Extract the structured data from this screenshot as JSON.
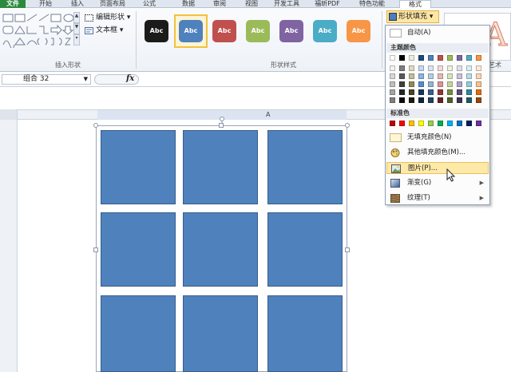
{
  "tabs": [
    {
      "label": "文件",
      "kind": "file"
    },
    {
      "label": "开始"
    },
    {
      "label": "插入"
    },
    {
      "label": "页面布局"
    },
    {
      "label": "公式"
    },
    {
      "label": "数据"
    },
    {
      "label": "审阅"
    },
    {
      "label": "视图"
    },
    {
      "label": "开发工具"
    },
    {
      "label": "福昕PDF"
    },
    {
      "label": "特色功能"
    },
    {
      "label": "格式",
      "kind": "active"
    }
  ],
  "ribbon": {
    "insert_shapes": {
      "edit_shape_label": "编辑形状",
      "text_box_label": "文本框",
      "group_label": "插入形状"
    },
    "shape_styles": {
      "group_label": "形状样式",
      "swatch_text": "Abc",
      "swatches": [
        {
          "color": "#1b1b1b"
        },
        {
          "color": "#4f81bd",
          "selected": true
        },
        {
          "color": "#c0504d"
        },
        {
          "color": "#9bbb59"
        },
        {
          "color": "#8064a2"
        },
        {
          "color": "#4bacc6"
        },
        {
          "color": "#f79646"
        }
      ]
    },
    "fill_button_label": "形状填充",
    "art_group_label": "艺术"
  },
  "formula_bar": {
    "name_box": "组合 32",
    "fx_label": "fx"
  },
  "sheet": {
    "column_header": "A"
  },
  "dropdown": {
    "auto_label": "自动(A)",
    "theme_colors_header": "主题颜色",
    "standard_colors_header": "标准色",
    "no_fill_label": "无填充颜色(N)",
    "more_colors_label": "其他填充颜色(M)...",
    "picture_label": "图片(P)...",
    "gradient_label": "渐变(G)",
    "texture_label": "纹理(T)",
    "theme_top_row": [
      "#ffffff",
      "#000000",
      "#eeece1",
      "#1f497d",
      "#4f81bd",
      "#c0504d",
      "#9bbb59",
      "#8064a2",
      "#4bacc6",
      "#f79646"
    ],
    "theme_shades": [
      [
        "#f2f2f2",
        "#7f7f7f",
        "#ddd9c3",
        "#c6d9f0",
        "#dbe5f1",
        "#f2dcdb",
        "#ebf1dd",
        "#e5e0ec",
        "#dbeef3",
        "#fdeada"
      ],
      [
        "#d8d8d8",
        "#595959",
        "#c4bd97",
        "#8db3e2",
        "#b8cce4",
        "#e5b9b7",
        "#d7e3bc",
        "#ccc1d9",
        "#b7dde8",
        "#fbd5b5"
      ],
      [
        "#bfbfbf",
        "#3f3f3f",
        "#938953",
        "#548dd4",
        "#95b3d7",
        "#d99694",
        "#c3d69b",
        "#b2a2c7",
        "#92cddc",
        "#fac08f"
      ],
      [
        "#a5a5a5",
        "#262626",
        "#494429",
        "#17365d",
        "#366092",
        "#953734",
        "#76923c",
        "#5f497a",
        "#31859b",
        "#e36c09"
      ],
      [
        "#7f7f7f",
        "#0c0c0c",
        "#1d1b10",
        "#0f243e",
        "#244061",
        "#632423",
        "#4f6128",
        "#3f3151",
        "#205867",
        "#974806"
      ]
    ],
    "standard_colors": [
      "#c00000",
      "#ff0000",
      "#ffc000",
      "#ffff00",
      "#92d050",
      "#00b050",
      "#00b0f0",
      "#0070c0",
      "#002060",
      "#7030a0"
    ]
  },
  "colors": {
    "tile_fill": "#4f81bd",
    "tile_border": "#385d8a",
    "highlight": "#fde9a8"
  }
}
